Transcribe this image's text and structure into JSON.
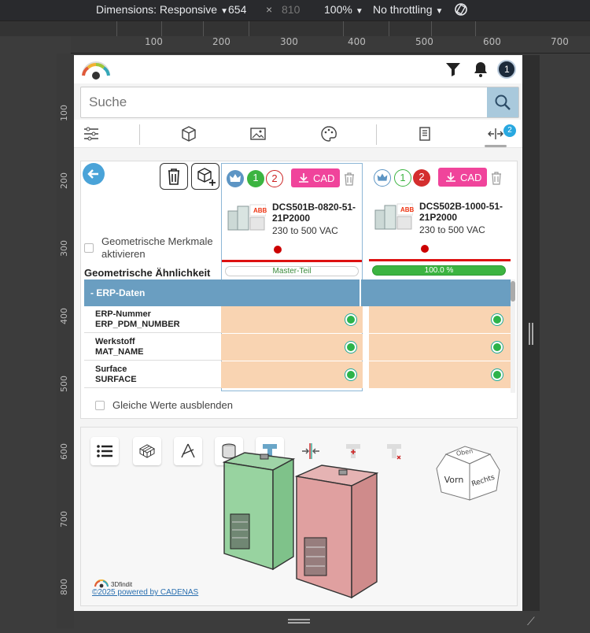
{
  "devtools": {
    "dimensions_label": "Dimensions: Responsive",
    "width": "654",
    "times": "×",
    "height": "810",
    "zoom": "100%",
    "throttling": "No throttling",
    "ruler_top": [
      "100",
      "200",
      "300",
      "400",
      "500",
      "600",
      "700"
    ],
    "ruler_left": [
      "100",
      "200",
      "300",
      "400",
      "500",
      "600",
      "700",
      "800"
    ]
  },
  "search": {
    "placeholder": "Suche"
  },
  "header": {
    "user_initial": "1"
  },
  "tabs": {
    "compare_badge": "2"
  },
  "compare": {
    "geo_checkbox_label": "Geometrische Merkmale aktivieren",
    "geo_similarity_title": "Geometrische Ähnlichkeit",
    "erp_section_label": "- ERP-Daten",
    "hide_equal_label": "Gleiche Werte ausblenden",
    "rows": [
      {
        "label1": "ERP-Nummer",
        "label2": "ERP_PDM_NUMBER"
      },
      {
        "label1": "Werkstoff",
        "label2": "MAT_NAME"
      },
      {
        "label1": "Surface",
        "label2": "SURFACE"
      }
    ],
    "columns": [
      {
        "num1": "1",
        "num2": "2",
        "cad_label": "CAD",
        "brand": "ABB",
        "name": "DCS501B-0820-51-21P2000",
        "desc": "230 to 500 VAC",
        "similarity": "Master-Teil"
      },
      {
        "num1": "1",
        "num2": "2",
        "cad_label": "CAD",
        "brand": "ABB",
        "name": "DCS502B-1000-51-21P2000",
        "desc": "230 to 500 VAC",
        "similarity": "100.0 %"
      }
    ]
  },
  "viewer": {
    "cube_top": "Oben",
    "cube_front": "Vorn",
    "cube_right": "Rechts",
    "brand_label": "3Dfindit",
    "powered_by": "©2025 powered by CADENAS"
  },
  "colors": {
    "accent": "#4aa3d8",
    "cad_pink": "#f0449b",
    "erp_band": "#6a9ec1",
    "cell_orange": "#f9d4b2",
    "match_green": "#2db34a",
    "model_green": "#7fc98a",
    "model_red": "#d98a8a"
  }
}
